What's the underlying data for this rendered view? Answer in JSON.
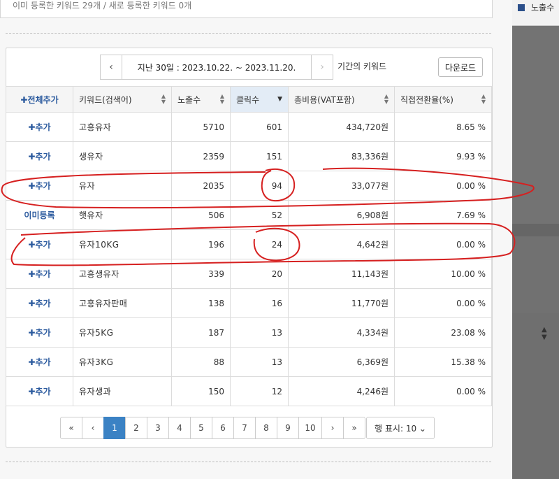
{
  "top": {
    "summary_text": "이미 등록한 키워드 29개 / 새로 등록한 키워드 0개"
  },
  "right_panel": {
    "legend_label": "노출수",
    "legend_color": "#2b4f8a"
  },
  "period": {
    "prev_icon": "chevron-left-icon",
    "next_icon": "chevron-right-icon",
    "range_text": "지난 30일 : 2023.10.22. ~ 2023.11.20.",
    "suffix_label": "기간의 키워드"
  },
  "download_label": "다운로드",
  "table": {
    "headers": {
      "add_all": "✚전체추가",
      "keyword": "키워드(검색어)",
      "impressions": "노출수",
      "clicks": "클릭수",
      "cost": "총비용(VAT포함)",
      "conversion": "직접전환율(%)"
    },
    "rows": [
      {
        "action": "✚추가",
        "keyword": "고흥유자",
        "impressions": "5710",
        "clicks": "601",
        "cost": "434,720원",
        "conversion": "8.65 %"
      },
      {
        "action": "✚추가",
        "keyword": "생유자",
        "impressions": "2359",
        "clicks": "151",
        "cost": "83,336원",
        "conversion": "9.93 %"
      },
      {
        "action": "✚추가",
        "keyword": "유자",
        "impressions": "2035",
        "clicks": "94",
        "cost": "33,077원",
        "conversion": "0.00 %"
      },
      {
        "action": "이미등록",
        "keyword": "햇유자",
        "impressions": "506",
        "clicks": "52",
        "cost": "6,908원",
        "conversion": "7.69 %"
      },
      {
        "action": "✚추가",
        "keyword": "유자10KG",
        "impressions": "196",
        "clicks": "24",
        "cost": "4,642원",
        "conversion": "0.00 %"
      },
      {
        "action": "✚추가",
        "keyword": "고흥생유자",
        "impressions": "339",
        "clicks": "20",
        "cost": "11,143원",
        "conversion": "10.00 %"
      },
      {
        "action": "✚추가",
        "keyword": "고흥유자판매",
        "impressions": "138",
        "clicks": "16",
        "cost": "11,770원",
        "conversion": "0.00 %"
      },
      {
        "action": "✚추가",
        "keyword": "유자5KG",
        "impressions": "187",
        "clicks": "13",
        "cost": "4,334원",
        "conversion": "23.08 %"
      },
      {
        "action": "✚추가",
        "keyword": "유자3KG",
        "impressions": "88",
        "clicks": "13",
        "cost": "6,369원",
        "conversion": "15.38 %"
      },
      {
        "action": "✚추가",
        "keyword": "유자생과",
        "impressions": "150",
        "clicks": "12",
        "cost": "4,246원",
        "conversion": "0.00 %"
      }
    ]
  },
  "pagination": {
    "first": "«",
    "prev": "‹",
    "pages": [
      "1",
      "2",
      "3",
      "4",
      "5",
      "6",
      "7",
      "8",
      "9",
      "10"
    ],
    "current_page": "1",
    "next": "›",
    "last": "»",
    "rows_per_page_label": "행 표시: 10 ⌄"
  },
  "colors": {
    "accent": "#3b82c4",
    "link": "#2b5a9e",
    "annotation": "#d62020"
  }
}
